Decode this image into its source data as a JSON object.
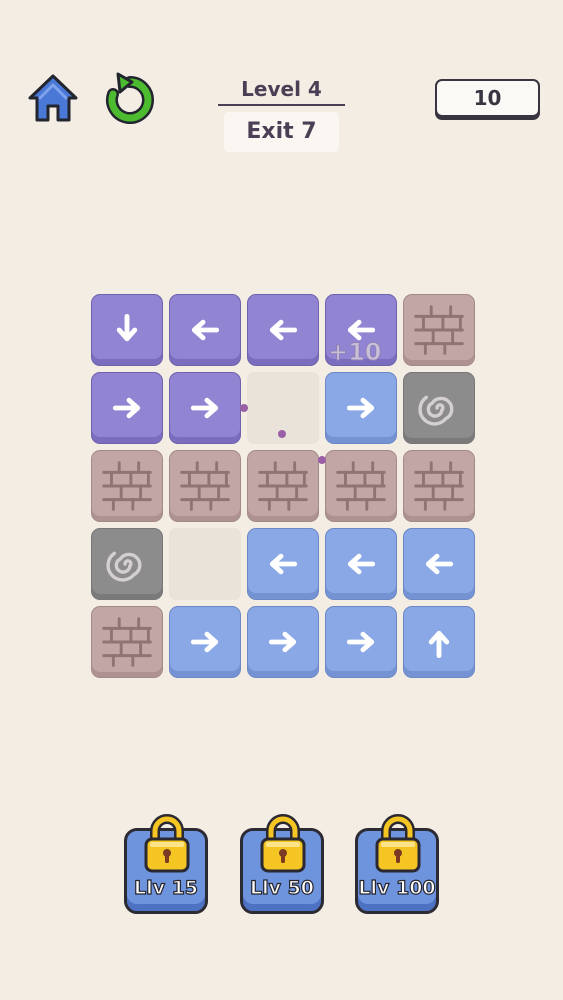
{
  "header": {
    "level_label": "Level 4",
    "exit_label": "Exit 7",
    "score": "10"
  },
  "board": {
    "popup": "+10",
    "rows": [
      [
        "purple:down",
        "purple:left",
        "purple:left",
        "purple:left",
        "brick"
      ],
      [
        "purple:right",
        "purple:right",
        "empty",
        "blue:right",
        "portal"
      ],
      [
        "brick",
        "brick",
        "brick",
        "brick",
        "brick"
      ],
      [
        "portal",
        "empty",
        "blue:left",
        "blue:left",
        "blue:left"
      ],
      [
        "brick",
        "blue:right",
        "blue:right",
        "blue:right",
        "blue:up"
      ]
    ]
  },
  "unlocks": [
    {
      "label": "Llv 15"
    },
    {
      "label": "Llv 50"
    },
    {
      "label": "Llv 100"
    }
  ],
  "colors": {
    "background": "#f3ede3",
    "purple_tile": "#9184d3",
    "blue_tile": "#8aa8e6",
    "brick_tile": "#c2a6a5",
    "portal_tile": "#8d8c8c",
    "home_icon": "#4a78d6",
    "restart_icon": "#4cbb2f",
    "lock_icon": "#f5c523"
  }
}
